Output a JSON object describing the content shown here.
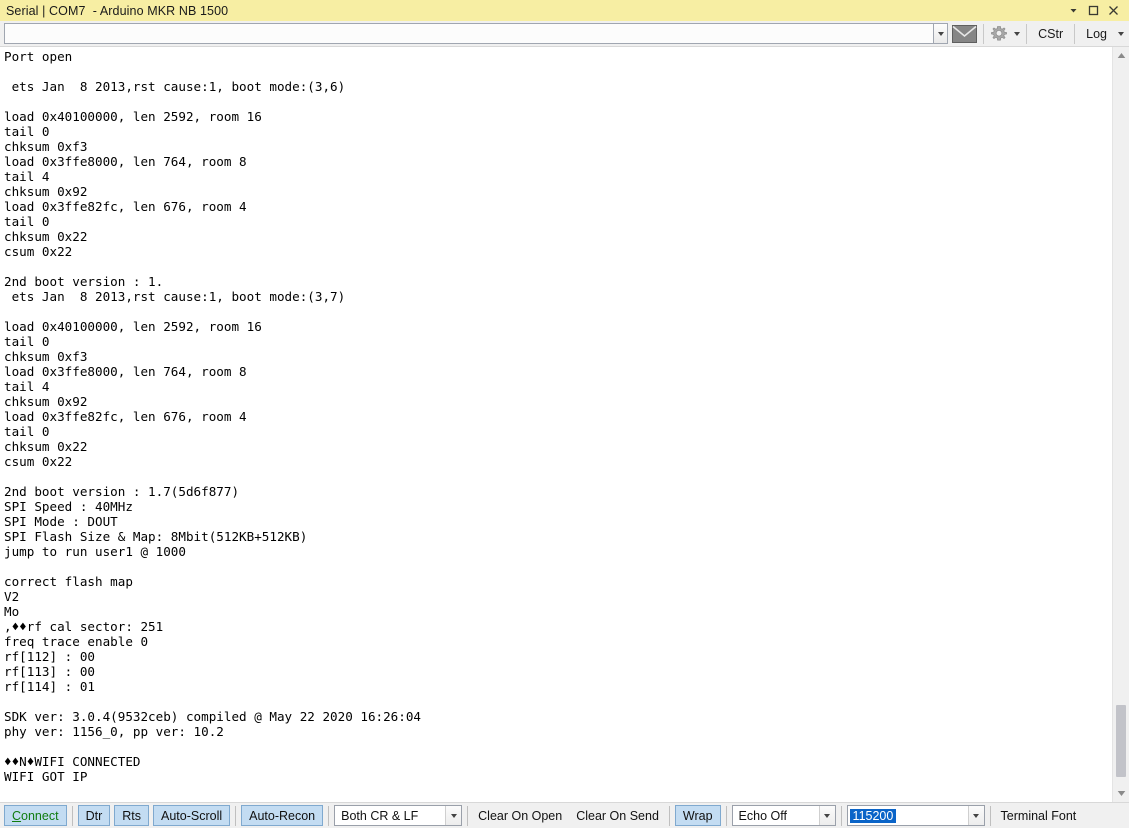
{
  "window": {
    "title": "Serial | COM7  - Arduino MKR NB 1500",
    "controls": [
      {
        "name": "window-menu-arrow",
        "glyph": "▾"
      },
      {
        "name": "maximize-button",
        "glyph": "▢"
      },
      {
        "name": "close-button",
        "glyph": "✕"
      }
    ]
  },
  "toolbar": {
    "send_input_value": "",
    "send_input_placeholder": "",
    "send_history_dropdown": "▾",
    "send_button_icon": "envelope-icon",
    "settings_button_icon": "gear-icon",
    "settings_dropdown": "▾",
    "cstr_label": "CStr",
    "log_label": "Log",
    "log_dropdown": "▾"
  },
  "terminal": {
    "lines": [
      "Port open",
      "",
      " ets Jan  8 2013,rst cause:1, boot mode:(3,6)",
      "",
      "load 0x40100000, len 2592, room 16",
      "tail 0",
      "chksum 0xf3",
      "load 0x3ffe8000, len 764, room 8",
      "tail 4",
      "chksum 0x92",
      "load 0x3ffe82fc, len 676, room 4",
      "tail 0",
      "chksum 0x22",
      "csum 0x22",
      "",
      "2nd boot version : 1.",
      " ets Jan  8 2013,rst cause:1, boot mode:(3,7)",
      "",
      "load 0x40100000, len 2592, room 16",
      "tail 0",
      "chksum 0xf3",
      "load 0x3ffe8000, len 764, room 8",
      "tail 4",
      "chksum 0x92",
      "load 0x3ffe82fc, len 676, room 4",
      "tail 0",
      "chksum 0x22",
      "csum 0x22",
      "",
      "2nd boot version : 1.7(5d6f877)",
      "SPI Speed : 40MHz",
      "SPI Mode : DOUT",
      "SPI Flash Size & Map: 8Mbit(512KB+512KB)",
      "jump to run user1 @ 1000",
      "",
      "correct flash map",
      "V2",
      "Mo",
      ",♦♦rf cal sector: 251",
      "freq trace enable 0",
      "rf[112] : 00",
      "rf[113] : 00",
      "rf[114] : 01",
      "",
      "SDK ver: 3.0.4(9532ceb) compiled @ May 22 2020 16:26:04",
      "phy ver: 1156_0, pp ver: 10.2",
      "",
      "♦♦N♦WIFI CONNECTED",
      "WIFI GOT IP"
    ]
  },
  "scrollbar": {
    "up_arrow": "▲",
    "down_arrow": "▼"
  },
  "bottombar": {
    "connect_label_prefix": "C",
    "connect_label_rest": "onnect",
    "dtr_label": "Dtr",
    "rts_label": "Rts",
    "autoscroll_label": "Auto-Scroll",
    "autorecon_label": "Auto-Recon",
    "line_ending_value": "Both CR & LF",
    "clear_on_open_label": "Clear On Open",
    "clear_on_send_label": "Clear On Send",
    "wrap_label": "Wrap",
    "echo_value": "Echo Off",
    "baud_value": "115200",
    "terminal_font_label": "Terminal Font",
    "dropdown_glyph": "▾"
  },
  "colors": {
    "titlebar": "#f7eea3",
    "toolbar": "#f0f0f0",
    "button_blue": "#c3dcf2",
    "button_border": "#7fa9cf",
    "connect_green": "#107c10",
    "selection_blue": "#0a64c8",
    "terminal_bg": "#ffffff",
    "terminal_fg": "#000000"
  }
}
